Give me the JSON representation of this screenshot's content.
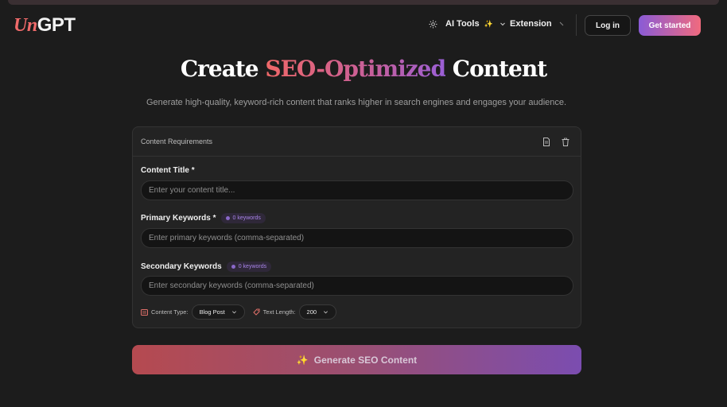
{
  "nav": {
    "logo_un": "Un",
    "logo_gpt": "GPT",
    "ai_tools": "AI Tools",
    "ai_tools_emoji": "✨",
    "extension": "Extension",
    "login": "Log in",
    "get_started": "Get started"
  },
  "hero": {
    "title_pre": "Create ",
    "title_highlight": "SEO-Optimized",
    "title_post": " Content",
    "subtitle": "Generate high-quality, keyword-rich content that ranks higher in search engines and engages your audience."
  },
  "card": {
    "header": "Content Requirements",
    "icons": [
      "document-icon",
      "trash-icon"
    ],
    "content_title": {
      "label": "Content Title *",
      "placeholder": "Enter your content title..."
    },
    "primary_keywords": {
      "label": "Primary Keywords *",
      "badge": "0 keywords",
      "placeholder": "Enter primary keywords (comma-separated)"
    },
    "secondary_keywords": {
      "label": "Secondary Keywords",
      "badge": "0 keywords",
      "placeholder": "Enter secondary keywords (comma-separated)"
    },
    "options": {
      "content_type_label": "Content Type:",
      "content_type_value": "Blog Post",
      "text_length_label": "Text Length:",
      "text_length_value": "200"
    }
  },
  "generate": {
    "label": "Generate SEO Content",
    "emoji": "✨"
  },
  "colors": {
    "background": "#1c1c1c",
    "accent_red": "#f06868",
    "accent_purple": "#8a5bd6",
    "card": "#232323"
  }
}
